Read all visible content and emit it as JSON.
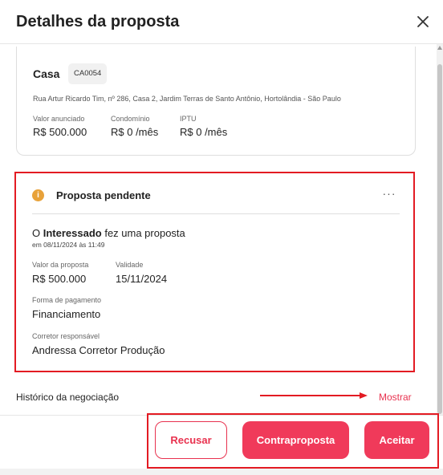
{
  "header": {
    "title": "Detalhes da proposta",
    "close_icon": "close-icon"
  },
  "property": {
    "type": "Casa",
    "code": "CA0054",
    "address": "Rua Artur Ricardo Tim, nº 286, Casa 2, Jardim Terras de Santo Antônio, Hortolândia - São Paulo",
    "fields": [
      {
        "label": "Valor anunciado",
        "value": "R$ 500.000"
      },
      {
        "label": "Condomínio",
        "value": "R$ 0 /mês"
      },
      {
        "label": "IPTU",
        "value": "R$ 0 /mês"
      }
    ]
  },
  "proposal": {
    "status_icon": "info-icon",
    "status_symbol": "i",
    "status_title": "Proposta pendente",
    "more_label": "···",
    "intro_prefix": "O ",
    "intro_bold": "Interessado",
    "intro_suffix": " fez uma proposta",
    "date": "em 08/11/2024 às 11:49",
    "value_label": "Valor da proposta",
    "value": "R$ 500.000",
    "validity_label": "Validade",
    "validity": "15/11/2024",
    "payment_label": "Forma de pagamento",
    "payment": "Financiamento",
    "broker_label": "Corretor responsável",
    "broker": "Andressa Corretor Produção"
  },
  "history": {
    "label": "Histórico da negociação",
    "show_label": "Mostrar"
  },
  "actions": {
    "refuse": "Recusar",
    "counter": "Contraproposta",
    "accept": "Aceitar"
  },
  "colors": {
    "accent": "#f03a5a",
    "annotation": "#e31b23",
    "status": "#e8a23a"
  }
}
